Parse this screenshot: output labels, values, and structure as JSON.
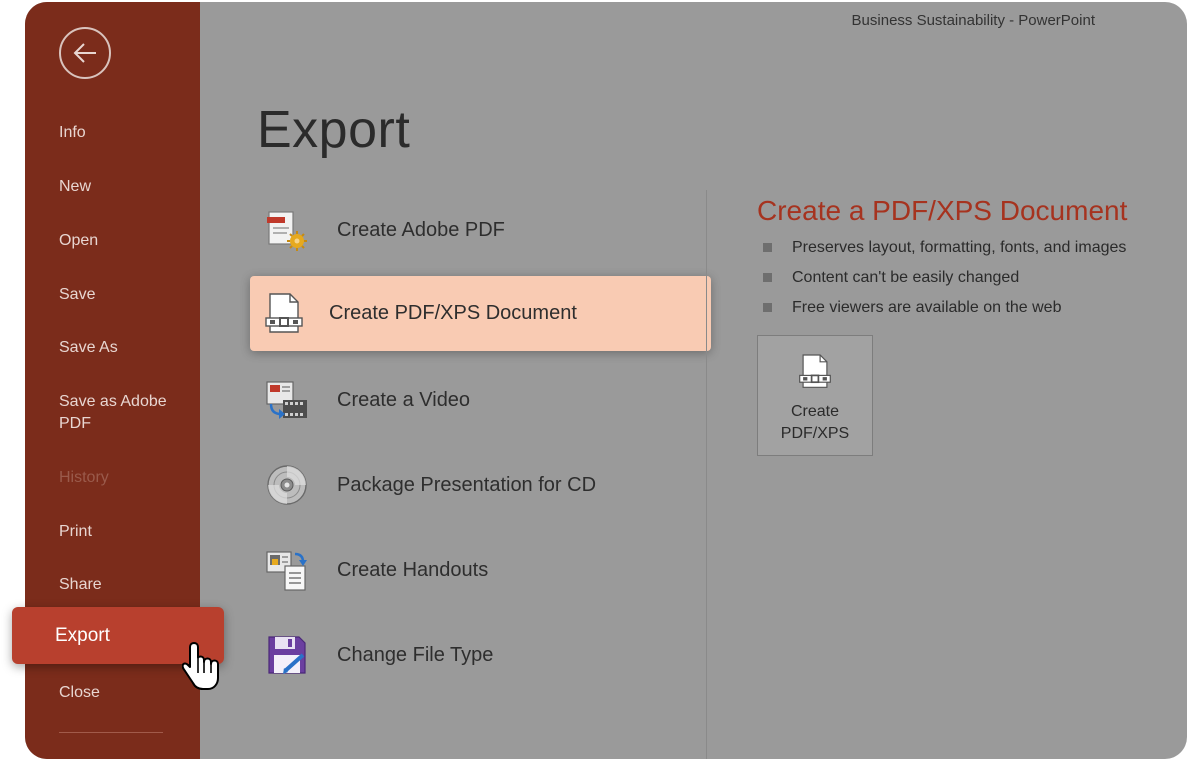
{
  "window": {
    "title": "Business Sustainability  -  PowerPoint"
  },
  "sidebar": {
    "items": [
      {
        "label": "Info"
      },
      {
        "label": "New"
      },
      {
        "label": "Open"
      },
      {
        "label": "Save"
      },
      {
        "label": "Save As"
      },
      {
        "label": "Save as Adobe PDF"
      },
      {
        "label": "History",
        "disabled": true
      },
      {
        "label": "Print"
      },
      {
        "label": "Share"
      },
      {
        "label": "Export",
        "active": true
      },
      {
        "label": "Close"
      }
    ]
  },
  "main": {
    "title": "Export",
    "options": [
      {
        "label": "Create Adobe PDF",
        "icon": "adobe-pdf-icon"
      },
      {
        "label": "Create PDF/XPS Document",
        "icon": "pdf-xps-document-icon",
        "selected": true
      },
      {
        "label": "Create a Video",
        "icon": "video-icon"
      },
      {
        "label": "Package Presentation for CD",
        "icon": "cd-icon"
      },
      {
        "label": "Create Handouts",
        "icon": "handouts-icon"
      },
      {
        "label": "Change File Type",
        "icon": "floppy-save-icon"
      }
    ]
  },
  "detail": {
    "title": "Create a PDF/XPS Document",
    "bullets": [
      "Preserves layout, formatting, fonts, and images",
      "Content can't be easily changed",
      "Free viewers are available on the web"
    ],
    "button_label_line1": "Create",
    "button_label_line2": "PDF/XPS"
  },
  "colors": {
    "sidebar_bg": "#7b2c1b",
    "accent": "#b8402e",
    "selected_option_bg": "#f9cbb3",
    "detail_title": "#a6331f",
    "content_bg": "#9a9a9a"
  }
}
